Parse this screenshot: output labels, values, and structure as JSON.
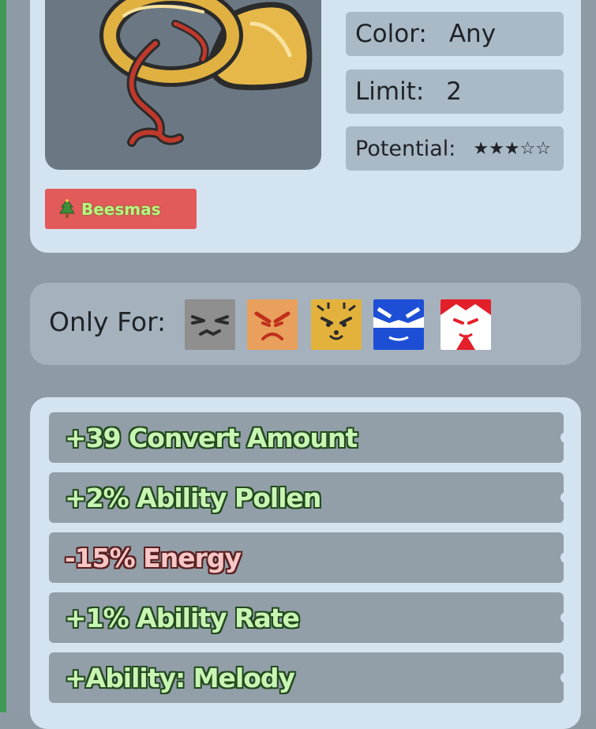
{
  "item": {
    "image_icon": "hunting-horn-icon",
    "tag": {
      "label": "Beesmas",
      "icon": "christmas-tree-icon",
      "color": "#e35a5a"
    }
  },
  "stats": {
    "color_label": "Color:",
    "color_value": "Any",
    "limit_label": "Limit:",
    "limit_value": "2",
    "potential_label": "Potential:",
    "potential_stars": "★★★☆☆",
    "potential_rating": 3,
    "potential_max": 5
  },
  "only_for": {
    "label": "Only For:",
    "bees": [
      "grumpy-bee-icon",
      "demon-bee-icon",
      "tabby-bee-icon",
      "vicious-bee-icon",
      "windy-bee-icon"
    ]
  },
  "abilities": [
    {
      "text": "+39 Convert Amount",
      "kind": "positive"
    },
    {
      "text": "+2% Ability Pollen",
      "kind": "positive"
    },
    {
      "text": "-15% Energy",
      "kind": "negative"
    },
    {
      "text": "+1% Ability Rate",
      "kind": "positive"
    },
    {
      "text": "+Ability: Melody",
      "kind": "positive"
    }
  ],
  "colors": {
    "panel": "#d4e3f0",
    "positive_text": "#c9f5b4",
    "negative_text": "#f7c7c7"
  }
}
